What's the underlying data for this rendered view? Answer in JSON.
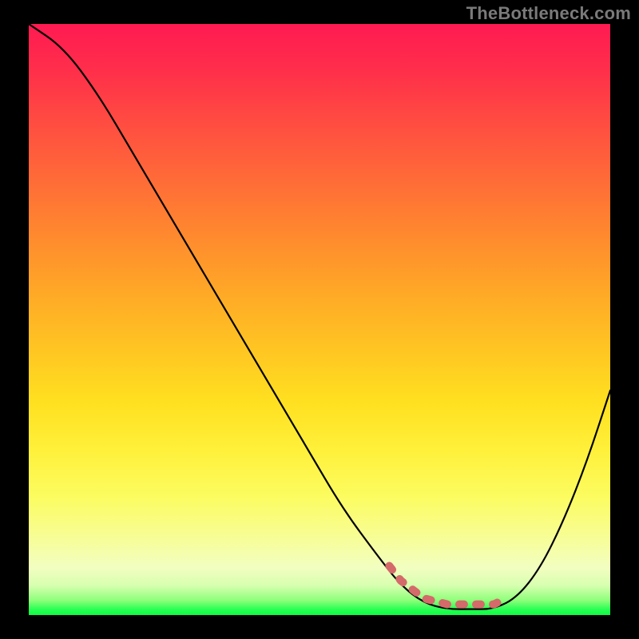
{
  "watermark": "TheBottleneck.com",
  "colors": {
    "page_bg": "#000000",
    "curve": "#000000",
    "marker": "#d46a6a",
    "gradient_top": "#ff1a52",
    "gradient_bottom": "#0bff42",
    "watermark_text": "#7a7a7a"
  },
  "chart_data": {
    "type": "line",
    "title": "",
    "xlabel": "",
    "ylabel": "",
    "xlim": [
      0,
      100
    ],
    "ylim": [
      0,
      100
    ],
    "x": [
      0,
      6,
      12,
      18,
      24,
      30,
      36,
      42,
      48,
      54,
      60,
      64,
      68,
      72,
      76,
      80,
      84,
      88,
      92,
      96,
      100
    ],
    "values": [
      100,
      96,
      88,
      78,
      68,
      58,
      48,
      38,
      28,
      18,
      10,
      5,
      2,
      1,
      1,
      1,
      3,
      8,
      16,
      26,
      38
    ],
    "highlight_range_x": [
      62,
      82
    ],
    "annotations": [],
    "grid": false,
    "legend": null
  }
}
